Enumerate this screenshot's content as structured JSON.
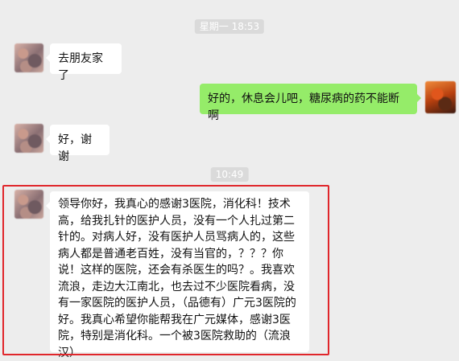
{
  "chat": {
    "timestamps": [
      "星期一 18:53",
      "10:49"
    ],
    "messages": [
      {
        "side": "left",
        "text": "去朋友家了"
      },
      {
        "side": "right",
        "text": "好的，休息会儿吧，糖尿病的药不能断啊"
      },
      {
        "side": "left",
        "text": "好，谢谢"
      },
      {
        "side": "left",
        "text": "领导你好，我真心的感谢3医院，消化科！技术高，给我扎针的医护人员，没有一个人扎过第二针的。对病人好，没有医护人员骂病人的，这些病人都是普通老百姓，没有当官的，？？？你说！这样的医院，还会有杀医生的吗？。我喜欢流浪，走边大江南北，也去过不少医院看病，没有一家医院的医护人员，（品德有）广元3医院的好。我真心希望你能帮我在广元媒体，感谢3医院，特别是消化科。一个被3医院救助的（流浪汉）"
      }
    ]
  },
  "colors": {
    "background": "#ededed",
    "incoming_bubble": "#ffffff",
    "outgoing_bubble": "#95ec69",
    "highlight_border": "#e0262b"
  }
}
